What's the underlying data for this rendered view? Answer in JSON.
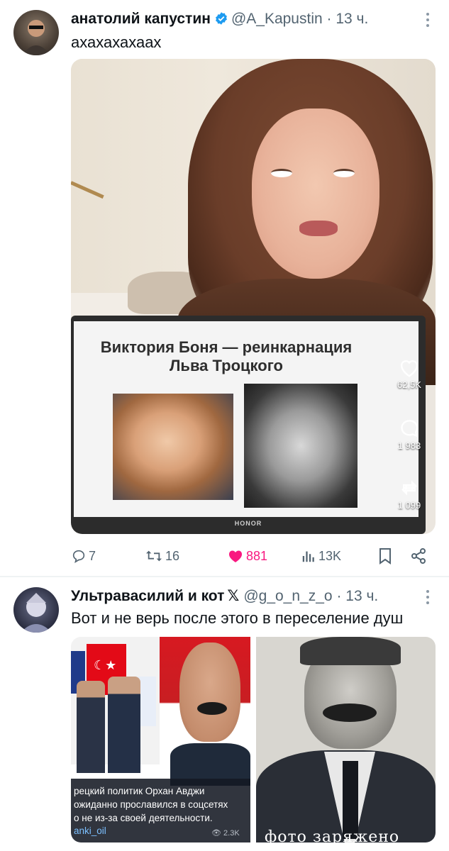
{
  "tweets": [
    {
      "author_name": "анатолий капустин",
      "verified": true,
      "handle": "@A_Kapustin",
      "separator": "·",
      "time": "13 ч.",
      "text": "ахахахахаах",
      "media": {
        "slide_title_line1": "Виктория Боня — реинкарнация",
        "slide_title_line2": "Льва Троцкого",
        "laptop_brand": "HONOR",
        "overlay": {
          "likes": "62,5K",
          "comments": "1 983",
          "reposts": "1 099"
        }
      },
      "actions": {
        "replies": "7",
        "retweets": "16",
        "likes": "881",
        "views": "13K"
      }
    },
    {
      "author_name": "Ультравасилий и кот",
      "badge": "𝕏",
      "handle": "@g_o_n_z_o",
      "separator": "·",
      "time": "13 ч.",
      "text": "Вот и не верь после этого в переселение душ",
      "media": {
        "caption_line1": "рецкий политик Орхан Авджи",
        "caption_line2": "ожиданно прославился в соцсетях",
        "caption_line3": "о не из-за своей деятельности.",
        "caption_user": "anki_oil",
        "caption_views": "2.3K",
        "stamp_text": "фото заряжено"
      }
    }
  ],
  "colors": {
    "like_active": "#f91880",
    "secondary_text": "#536471",
    "verified_blue": "#1d9bf0"
  }
}
